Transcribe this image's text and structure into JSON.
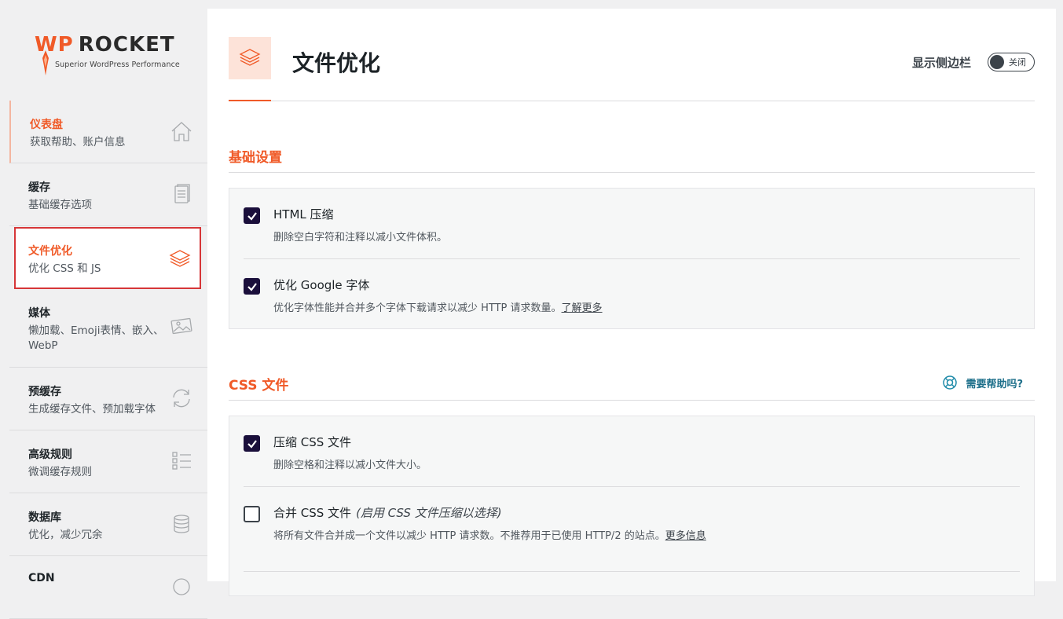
{
  "logo": {
    "brand_wp": "WP",
    "brand_rocket": "ROCKET",
    "tagline": "Superior WordPress Performance"
  },
  "nav": [
    {
      "title": "仪表盘",
      "sub": "获取帮助、账户信息",
      "icon": "home-icon"
    },
    {
      "title": "缓存",
      "sub": "基础缓存选项",
      "icon": "document-icon"
    },
    {
      "title": "文件优化",
      "sub": "优化 CSS 和 JS",
      "icon": "layers-icon"
    },
    {
      "title": "媒体",
      "sub": "懒加载、Emoji表情、嵌入、WebP",
      "icon": "image-icon"
    },
    {
      "title": "预缓存",
      "sub": "生成缓存文件、预加载字体",
      "icon": "refresh-icon"
    },
    {
      "title": "高级规则",
      "sub": "微调缓存规则",
      "icon": "list-icon"
    },
    {
      "title": "数据库",
      "sub": "优化，减少冗余",
      "icon": "database-icon"
    },
    {
      "title": "CDN",
      "sub": "",
      "icon": "globe-icon"
    }
  ],
  "header": {
    "title": "文件优化",
    "sidebar_toggle_label": "显示侧边栏",
    "toggle_state": "关闭"
  },
  "sections": {
    "basic": {
      "title": "基础设置",
      "options": [
        {
          "label": "HTML 压缩",
          "desc": "删除空白字符和注释以减小文件体积。",
          "checked": true
        },
        {
          "label": "优化 Google 字体",
          "desc": "优化字体性能并合并多个字体下载请求以减少 HTTP 请求数量。",
          "link": "了解更多",
          "checked": true
        }
      ]
    },
    "css": {
      "title": "CSS 文件",
      "help": "需要帮助吗?",
      "options": [
        {
          "label": "压缩 CSS 文件",
          "desc": "删除空格和注释以减小文件大小。",
          "checked": true
        },
        {
          "label": "合并 CSS 文件",
          "hint": "(启用 CSS 文件压缩以选择)",
          "desc": "将所有文件合并成一个文件以减少 HTTP 请求数。不推荐用于已使用 HTTP/2 的站点。",
          "link": "更多信息",
          "checked": false
        }
      ]
    }
  },
  "colors": {
    "accent": "#f05a28",
    "checkbox": "#1a0f3b",
    "active_border": "#d63638"
  }
}
